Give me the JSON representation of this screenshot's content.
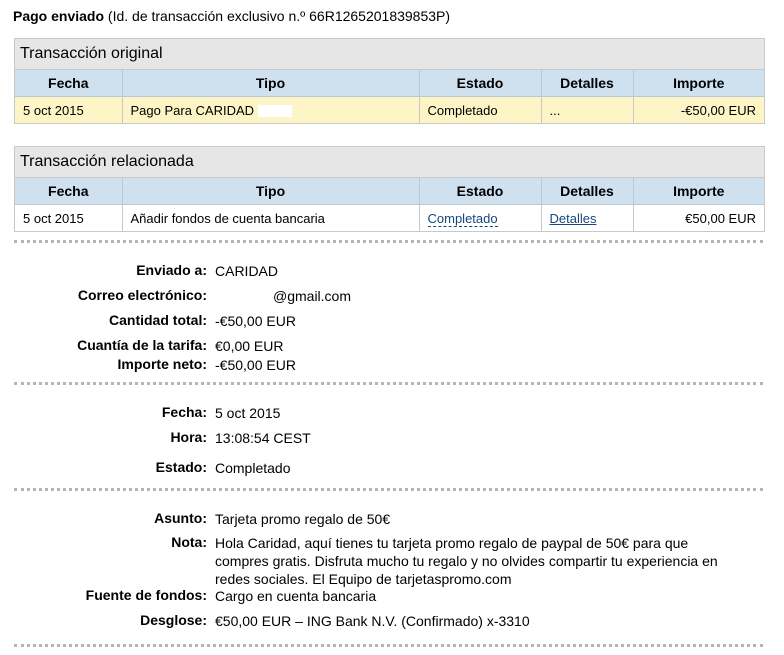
{
  "header": {
    "title": "Pago enviado",
    "subtitle": "(Id. de transacción exclusivo n.º 66R1265201839853P)"
  },
  "original": {
    "title": "Transacción original",
    "columns": [
      "Fecha",
      "Tipo",
      "Estado",
      "Detalles",
      "Importe"
    ],
    "row": {
      "fecha": "5 oct 2015",
      "tipo": "Pago Para CARIDAD",
      "estado": "Completado",
      "detalles": "...",
      "importe": "-€50,00 EUR"
    }
  },
  "related": {
    "title": "Transacción relacionada",
    "columns": [
      "Fecha",
      "Tipo",
      "Estado",
      "Detalles",
      "Importe"
    ],
    "row": {
      "fecha": "5 oct 2015",
      "tipo": "Añadir fondos de cuenta bancaria",
      "estado": "Completado",
      "detalles": "Detalles",
      "importe": "€50,00 EUR"
    }
  },
  "payment": {
    "enviado_label": "Enviado a:",
    "enviado_value": "CARIDAD",
    "correo_label": "Correo electrónico:",
    "correo_value": "@gmail.com",
    "cantidad_label": "Cantidad total:",
    "cantidad_value": "-€50,00 EUR",
    "tarifa_label": "Cuantía de la tarifa:",
    "tarifa_value": "€0,00 EUR",
    "neto_label": "Importe neto:",
    "neto_value": "-€50,00 EUR"
  },
  "timing": {
    "fecha_label": "Fecha:",
    "fecha_value": "5 oct 2015",
    "hora_label": "Hora:",
    "hora_value": "13:08:54 CEST",
    "estado_label": "Estado:",
    "estado_value": "Completado"
  },
  "message": {
    "asunto_label": "Asunto:",
    "asunto_value": "Tarjeta promo regalo de 50€",
    "nota_label": "Nota:",
    "nota_value": "Hola Caridad, aquí tienes tu tarjeta promo regalo de paypal de 50€ para que compres gratis. Disfruta mucho tu regalo y no olvides compartir tu experiencia en redes sociales. El Equipo de tarjetaspromo.com",
    "fuente_label": "Fuente de fondos:",
    "fuente_value": "Cargo en cuenta bancaria",
    "desglose_label": "Desglose:",
    "desglose_value": "€50,00 EUR – ING Bank N.V. (Confirmado) x-3310"
  },
  "colors": {
    "header_bg": "#cfe0ef",
    "highlight_row": "#fdf5c6",
    "link": "#16487e",
    "panel_title_bg": "#e6e6e6"
  }
}
